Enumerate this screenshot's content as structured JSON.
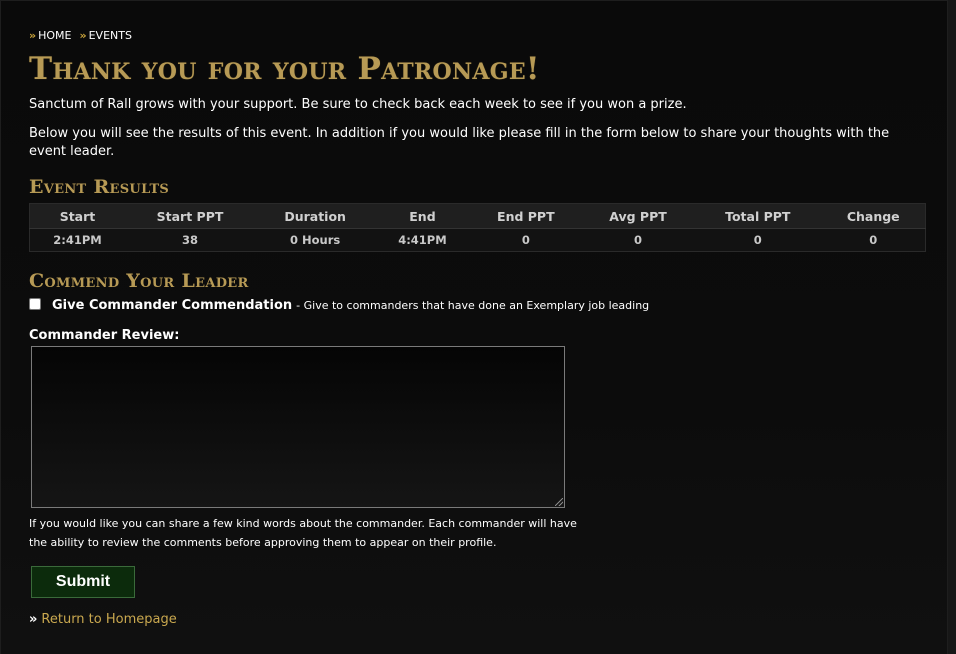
{
  "breadcrumb": [
    {
      "label": "HOME"
    },
    {
      "label": "EVENTS"
    }
  ],
  "page": {
    "title": "Thank you for your Patronage!",
    "intro": "Sanctum of Rall grows with your support. Be sure to check back each week to see if you won a prize.",
    "intro2": "Below you will see the results of this event. In addition if you would like please fill in the form below to share your thoughts with the event leader."
  },
  "results": {
    "title": "Event Results",
    "headers": [
      "Start",
      "Start PPT",
      "Duration",
      "End",
      "End PPT",
      "Avg PPT",
      "Total PPT",
      "Change"
    ],
    "row": [
      "2:41PM",
      "38",
      "0 Hours",
      "4:41PM",
      "0",
      "0",
      "0",
      "0"
    ]
  },
  "commend": {
    "title": "Commend Your Leader",
    "checkbox_label": "Give Commander Commendation",
    "checkbox_desc": "- Give to commanders that have done an Exemplary job leading",
    "checked": false,
    "review_label": "Commander Review:",
    "review_value": "",
    "help_text": "If you would like you can share a few kind words about the commander. Each commander will have the ability to review the comments before approving them to appear on their profile.",
    "submit_label": "Submit"
  },
  "footer": {
    "return_label": "Return to Homepage"
  },
  "colors": {
    "gold": "#b79a55",
    "link_gold": "#c9a84f",
    "button_green": "#0c2b0c"
  }
}
